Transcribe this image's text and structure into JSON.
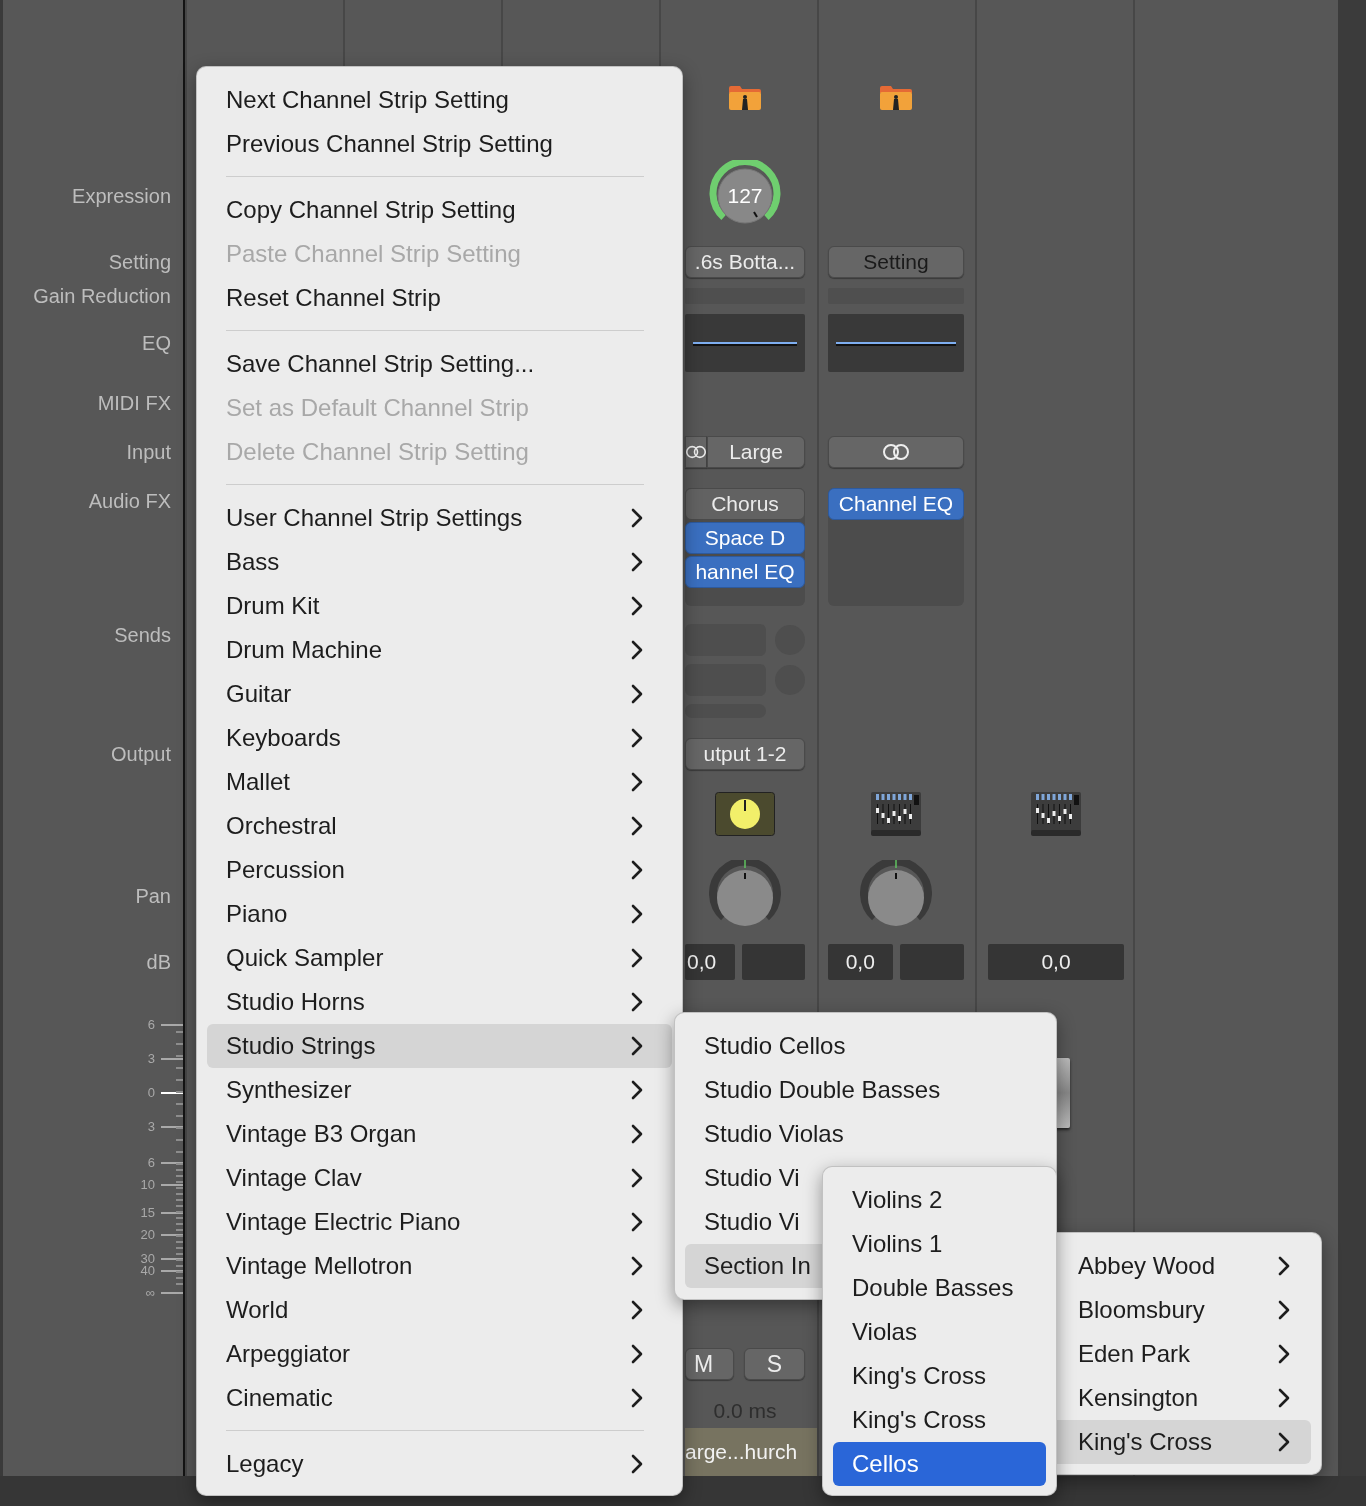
{
  "row_labels": {
    "expression": "Expression",
    "setting": "Setting",
    "gain_reduction": "Gain Reduction",
    "eq": "EQ",
    "midi_fx": "MIDI FX",
    "input": "Input",
    "audio_fx": "Audio FX",
    "sends": "Sends",
    "output": "Output",
    "pan": "Pan",
    "db": "dB"
  },
  "db_scale": [
    "6",
    "3",
    "0",
    "3",
    "6",
    "10",
    "15",
    "20",
    "30",
    "40",
    "∞"
  ],
  "strips": [
    {
      "kind": "track",
      "top_icon": {
        "kind": "folder"
      },
      "knob": "127",
      "setting": ".6s Botta...",
      "link": "Large",
      "audio_fx": [
        {
          "name": "Chorus",
          "active": false
        },
        {
          "name": "Space D",
          "active": true
        },
        {
          "name": "hannel EQ",
          "active": true
        }
      ],
      "output": "utput 1-2",
      "strip_icon": {
        "kind": "dial"
      },
      "pan": true,
      "db": "0,0",
      "mute": "M",
      "solo": "S",
      "delay": "0.0 ms",
      "name": "arge...hurch"
    },
    {
      "kind": "bus",
      "top_icon": {
        "kind": "folder"
      },
      "setting": "Setting",
      "audio_fx": [
        {
          "name": "Channel EQ",
          "active": true
        }
      ],
      "strip_icon": {
        "kind": "mixer"
      },
      "pan": true,
      "db": "0,0"
    },
    {
      "kind": "master",
      "strip_icon": {
        "kind": "mixer"
      },
      "db": "0,0"
    }
  ],
  "menu": {
    "focused": false,
    "groups": [
      [
        {
          "label": "Next Channel Strip Setting",
          "disabled": false,
          "submenu": false,
          "selected": false
        },
        {
          "label": "Previous Channel Strip Setting",
          "disabled": false,
          "submenu": false,
          "selected": false
        }
      ],
      [
        {
          "label": "Copy Channel Strip Setting",
          "disabled": false,
          "submenu": false,
          "selected": false
        },
        {
          "label": "Paste Channel Strip Setting",
          "disabled": true,
          "submenu": false,
          "selected": false
        },
        {
          "label": "Reset Channel Strip",
          "disabled": false,
          "submenu": false,
          "selected": false
        }
      ],
      [
        {
          "label": "Save Channel Strip Setting...",
          "disabled": false,
          "submenu": false,
          "selected": false
        },
        {
          "label": "Set as Default Channel Strip",
          "disabled": true,
          "submenu": false,
          "selected": false
        },
        {
          "label": "Delete Channel Strip Setting",
          "disabled": true,
          "submenu": false,
          "selected": false
        }
      ],
      [
        {
          "label": "User Channel Strip Settings",
          "disabled": false,
          "submenu": true,
          "selected": false
        },
        {
          "label": "Bass",
          "disabled": false,
          "submenu": true,
          "selected": false
        },
        {
          "label": "Drum Kit",
          "disabled": false,
          "submenu": true,
          "selected": false
        },
        {
          "label": "Drum Machine",
          "disabled": false,
          "submenu": true,
          "selected": false
        },
        {
          "label": "Guitar",
          "disabled": false,
          "submenu": true,
          "selected": false
        },
        {
          "label": "Keyboards",
          "disabled": false,
          "submenu": true,
          "selected": false
        },
        {
          "label": "Mallet",
          "disabled": false,
          "submenu": true,
          "selected": false
        },
        {
          "label": "Orchestral",
          "disabled": false,
          "submenu": true,
          "selected": false
        },
        {
          "label": "Percussion",
          "disabled": false,
          "submenu": true,
          "selected": false
        },
        {
          "label": "Piano",
          "disabled": false,
          "submenu": true,
          "selected": false
        },
        {
          "label": "Quick Sampler",
          "disabled": false,
          "submenu": true,
          "selected": false
        },
        {
          "label": "Studio Horns",
          "disabled": false,
          "submenu": true,
          "selected": false
        },
        {
          "label": "Studio Strings",
          "disabled": false,
          "submenu": true,
          "selected": true
        },
        {
          "label": "Synthesizer",
          "disabled": false,
          "submenu": true,
          "selected": false
        },
        {
          "label": "Vintage B3 Organ",
          "disabled": false,
          "submenu": true,
          "selected": false
        },
        {
          "label": "Vintage Clav",
          "disabled": false,
          "submenu": true,
          "selected": false
        },
        {
          "label": "Vintage Electric Piano",
          "disabled": false,
          "submenu": true,
          "selected": false
        },
        {
          "label": "Vintage Mellotron",
          "disabled": false,
          "submenu": true,
          "selected": false
        },
        {
          "label": "World",
          "disabled": false,
          "submenu": true,
          "selected": false
        },
        {
          "label": "Arpeggiator",
          "disabled": false,
          "submenu": true,
          "selected": false
        },
        {
          "label": "Cinematic",
          "disabled": false,
          "submenu": true,
          "selected": false
        }
      ],
      [
        {
          "label": "Legacy",
          "disabled": false,
          "submenu": true,
          "selected": false
        }
      ]
    ]
  },
  "submenus": [
    {
      "focused": false,
      "items": [
        {
          "label": "Studio Cellos",
          "selected": false
        },
        {
          "label": "Studio Double Basses",
          "selected": false
        },
        {
          "label": "Studio Violas",
          "selected": false
        },
        {
          "label": "Studio Vi",
          "selected": false
        },
        {
          "label": "Studio Vi",
          "selected": false
        },
        {
          "label": "Section In",
          "selected": true
        }
      ]
    },
    {
      "focused": true,
      "items": [
        {
          "label": "Violins 2",
          "submenu": false,
          "selected": false
        },
        {
          "label": "Violins 1",
          "submenu": false,
          "selected": false
        },
        {
          "label": "Double Basses",
          "submenu": false,
          "selected": false
        },
        {
          "label": "Violas",
          "submenu": false,
          "selected": false
        },
        {
          "label": "King's Cross",
          "submenu": false,
          "selected": false
        },
        {
          "label": "King's Cross",
          "submenu": false,
          "selected": false
        },
        {
          "label": "Cellos",
          "submenu": false,
          "selected": true
        }
      ]
    },
    {
      "focused": false,
      "items": [
        {
          "label": "Abbey Wood",
          "submenu": true,
          "selected": false
        },
        {
          "label": "Bloomsbury",
          "submenu": true,
          "selected": false
        },
        {
          "label": "Eden Park",
          "submenu": true,
          "selected": false
        },
        {
          "label": "Kensington",
          "submenu": true,
          "selected": false
        },
        {
          "label": "King's Cross",
          "submenu": true,
          "selected": true
        }
      ]
    }
  ]
}
